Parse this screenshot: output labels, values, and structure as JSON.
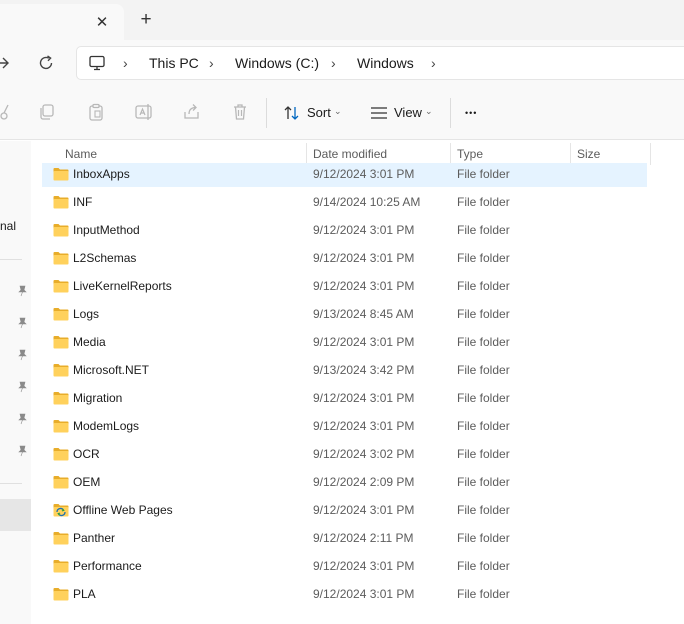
{
  "tabbar": {
    "close_glyph": "✕",
    "new_tab_glyph": "+"
  },
  "breadcrumb": {
    "items": [
      "This PC",
      "Windows (C:)",
      "Windows"
    ],
    "separator": "›"
  },
  "commandbar": {
    "sort_label": "Sort",
    "view_label": "View",
    "more_glyph": "•••",
    "caret_glyph": "⌄"
  },
  "sidebar": {
    "partial_label": "nal"
  },
  "columns": {
    "name": "Name",
    "date_modified": "Date modified",
    "type": "Type",
    "size": "Size",
    "sort_glyph": "⌃"
  },
  "files": [
    {
      "name": "InboxApps",
      "date": "9/12/2024 3:01 PM",
      "type": "File folder",
      "icon": "folder-icon",
      "selected": true
    },
    {
      "name": "INF",
      "date": "9/14/2024 10:25 AM",
      "type": "File folder",
      "icon": "folder-icon"
    },
    {
      "name": "InputMethod",
      "date": "9/12/2024 3:01 PM",
      "type": "File folder",
      "icon": "folder-icon"
    },
    {
      "name": "L2Schemas",
      "date": "9/12/2024 3:01 PM",
      "type": "File folder",
      "icon": "folder-icon"
    },
    {
      "name": "LiveKernelReports",
      "date": "9/12/2024 3:01 PM",
      "type": "File folder",
      "icon": "folder-icon"
    },
    {
      "name": "Logs",
      "date": "9/13/2024 8:45 AM",
      "type": "File folder",
      "icon": "folder-icon"
    },
    {
      "name": "Media",
      "date": "9/12/2024 3:01 PM",
      "type": "File folder",
      "icon": "folder-icon"
    },
    {
      "name": "Microsoft.NET",
      "date": "9/13/2024 3:42 PM",
      "type": "File folder",
      "icon": "folder-icon"
    },
    {
      "name": "Migration",
      "date": "9/12/2024 3:01 PM",
      "type": "File folder",
      "icon": "folder-icon"
    },
    {
      "name": "ModemLogs",
      "date": "9/12/2024 3:01 PM",
      "type": "File folder",
      "icon": "folder-icon"
    },
    {
      "name": "OCR",
      "date": "9/12/2024 3:02 PM",
      "type": "File folder",
      "icon": "folder-icon"
    },
    {
      "name": "OEM",
      "date": "9/12/2024 2:09 PM",
      "type": "File folder",
      "icon": "folder-icon"
    },
    {
      "name": "Offline Web Pages",
      "date": "9/12/2024 3:01 PM",
      "type": "File folder",
      "icon": "offline-web-pages-folder-icon"
    },
    {
      "name": "Panther",
      "date": "9/12/2024 2:11 PM",
      "type": "File folder",
      "icon": "folder-icon"
    },
    {
      "name": "Performance",
      "date": "9/12/2024 3:01 PM",
      "type": "File folder",
      "icon": "folder-icon"
    },
    {
      "name": "PLA",
      "date": "9/12/2024 3:01 PM",
      "type": "File folder",
      "icon": "folder-icon"
    }
  ],
  "colors": {
    "folder": "#ffd15c",
    "folder_tab": "#e8ad2a",
    "selection": "#e5f3ff",
    "accent_blue": "#0067c0"
  }
}
